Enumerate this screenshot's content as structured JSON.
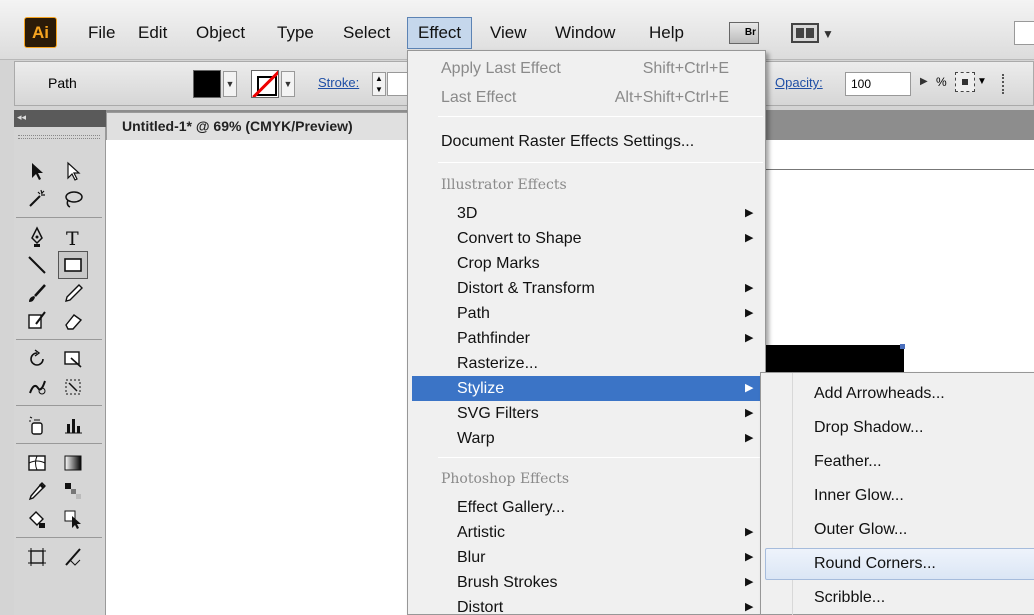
{
  "app": {
    "logo_text": "Ai",
    "menubar": [
      "File",
      "Edit",
      "Object",
      "Type",
      "Select",
      "Effect",
      "View",
      "Window",
      "Help"
    ],
    "active_menu": "Effect",
    "bridge_label": "Br"
  },
  "control_bar": {
    "selection_label": "Path",
    "stroke_label": "Stroke:",
    "opacity_label": "Opacity:",
    "opacity_value": "100",
    "opacity_unit": "%"
  },
  "document": {
    "tab_title": "Untitled-1* @ 69% (CMYK/Preview)"
  },
  "effect_menu": {
    "top_items": [
      {
        "label": "Apply Last Effect",
        "shortcut": "Shift+Ctrl+E",
        "enabled": false
      },
      {
        "label": "Last Effect",
        "shortcut": "Alt+Shift+Ctrl+E",
        "enabled": false
      }
    ],
    "raster_settings": "Document Raster Effects Settings...",
    "illustrator_header": "Illustrator Effects",
    "illustrator_items": [
      {
        "label": "3D",
        "submenu": true
      },
      {
        "label": "Convert to Shape",
        "submenu": true
      },
      {
        "label": "Crop Marks",
        "submenu": false
      },
      {
        "label": "Distort & Transform",
        "submenu": true
      },
      {
        "label": "Path",
        "submenu": true
      },
      {
        "label": "Pathfinder",
        "submenu": true
      },
      {
        "label": "Rasterize...",
        "submenu": false
      },
      {
        "label": "Stylize",
        "submenu": true,
        "highlighted": true
      },
      {
        "label": "SVG Filters",
        "submenu": true
      },
      {
        "label": "Warp",
        "submenu": true
      }
    ],
    "photoshop_header": "Photoshop Effects",
    "photoshop_items": [
      {
        "label": "Effect Gallery...",
        "submenu": false
      },
      {
        "label": "Artistic",
        "submenu": true
      },
      {
        "label": "Blur",
        "submenu": true
      },
      {
        "label": "Brush Strokes",
        "submenu": true
      },
      {
        "label": "Distort",
        "submenu": true
      }
    ]
  },
  "stylize_submenu": {
    "items": [
      "Add Arrowheads...",
      "Drop Shadow...",
      "Feather...",
      "Inner Glow...",
      "Outer Glow...",
      "Round Corners...",
      "Scribble..."
    ],
    "hovered": "Round Corners..."
  },
  "colors": {
    "menu_highlight": "#3b74c6",
    "submenu_hover": "#dbe6f5",
    "fill_swatch": "#000000",
    "ai_logo": "#f7a520"
  },
  "icons": {
    "submenu_arrow": "▶",
    "dropdown_caret": "▼"
  }
}
